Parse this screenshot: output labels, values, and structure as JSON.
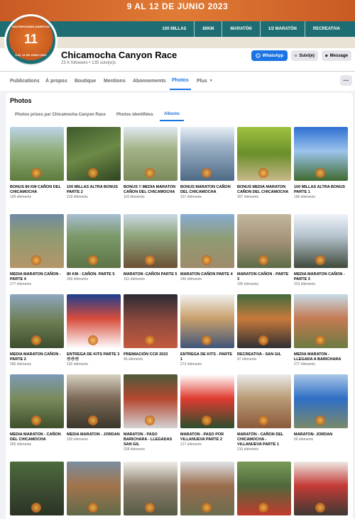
{
  "cover": {
    "title": "9 AL 12 DE JUNIO 2023",
    "categories": [
      "100 MILLAS",
      "80KM",
      "MARATÓN",
      "1/2 MARATÓN",
      "RECREATIVA"
    ]
  },
  "avatar": {
    "top_text": "INSCRIPCIONES ABIERTAS",
    "number": "11",
    "bottom_text": "9 AL 12 DE JUNIO 2023"
  },
  "profile": {
    "name": "Chicamocha Canyon Race",
    "followers": "23 K followers • 135 suivi(e)s",
    "buttons": {
      "whatsapp": "WhatsApp",
      "follow": "Suivi(e)",
      "message": "Message"
    }
  },
  "tabs": [
    "Publications",
    "À propos",
    "Boutique",
    "Mentions",
    "Abonnements",
    "Photos",
    "Plus"
  ],
  "photos": {
    "heading": "Photos",
    "subtabs": [
      "Photos prises par Chicamocha Canyon Race",
      "Photos identifiées",
      "Albums"
    ]
  },
  "albums": [
    {
      "title": "BONUS 80 KM CAÑON DEL CHICAMOCHA",
      "count": "109 éléments"
    },
    {
      "title": "100 MILLAS ALTRA BONUS PARTE 2",
      "count": "219 éléments"
    },
    {
      "title": "BONUS !! MEDIA MARATON CAÑON DEL CHICAMOCHA",
      "count": "116 éléments"
    },
    {
      "title": "BONUS MARATON CAÑON DEL CHICAMOCHA",
      "count": "157 éléments"
    },
    {
      "title": "BONUS MEDIA MARATON CAÑON DEL CHICAMOCHA",
      "count": "207 éléments"
    },
    {
      "title": "100 MILLAS ALTRA BONUS PARTE 1",
      "count": "196 éléments"
    },
    {
      "title": "MEDIA MARATON CAÑON - PARTE 4",
      "count": "277 éléments"
    },
    {
      "title": "80 KM - CAÑON- PARTE 5",
      "count": "269 éléments"
    },
    {
      "title": "MARATON -CAÑON PARTE 5",
      "count": "151 éléments"
    },
    {
      "title": "MARATON CAÑON PARTE 4",
      "count": "246 éléments"
    },
    {
      "title": "MARATON CAÑON - PARTE 3",
      "count": "195 éléments"
    },
    {
      "title": "MEDIA MARATON CAÑON - PARTE 3",
      "count": "223 éléments"
    },
    {
      "title": "MEDIA MARATON CAÑON -PARTE 2",
      "count": "286 éléments"
    },
    {
      "title": "ENTREGA DE KITS PARTE 3 😎😎😎",
      "count": "102 éléments"
    },
    {
      "title": "PREMIACIÓN CCR 2023",
      "count": "46 éléments"
    },
    {
      "title": "ENTREGA DE KITS - PARTE 1",
      "count": "273 éléments"
    },
    {
      "title": "RECREATIVA - SAN GIL",
      "count": "97 éléments"
    },
    {
      "title": "MEDIA MARATON - LLEGADA A BARICHARA",
      "count": "277 éléments"
    },
    {
      "title": "MEDIA MARATON - CAÑON DEL CHICAMOCHA",
      "count": "265 éléments"
    },
    {
      "title": "MEDIA MARATON - JORDAN",
      "count": "200 éléments"
    },
    {
      "title": "MARATON - PASO BARICHARA - LLEGADAS SAN GIL",
      "count": "228 éléments"
    },
    {
      "title": "MARATON - PASO POR VILLANUEVA PARTE 2",
      "count": "217 éléments"
    },
    {
      "title": "MARATÓN - CAÑON DEL CHICAMOCHA - VILLANUEVA PARTE 1",
      "count": "210 éléments"
    },
    {
      "title": "MARATON- JORDAN",
      "count": "66 éléments"
    },
    {
      "title": "",
      "count": ""
    },
    {
      "title": "",
      "count": ""
    },
    {
      "title": "",
      "count": ""
    },
    {
      "title": "",
      "count": ""
    },
    {
      "title": "",
      "count": ""
    },
    {
      "title": "",
      "count": ""
    }
  ]
}
